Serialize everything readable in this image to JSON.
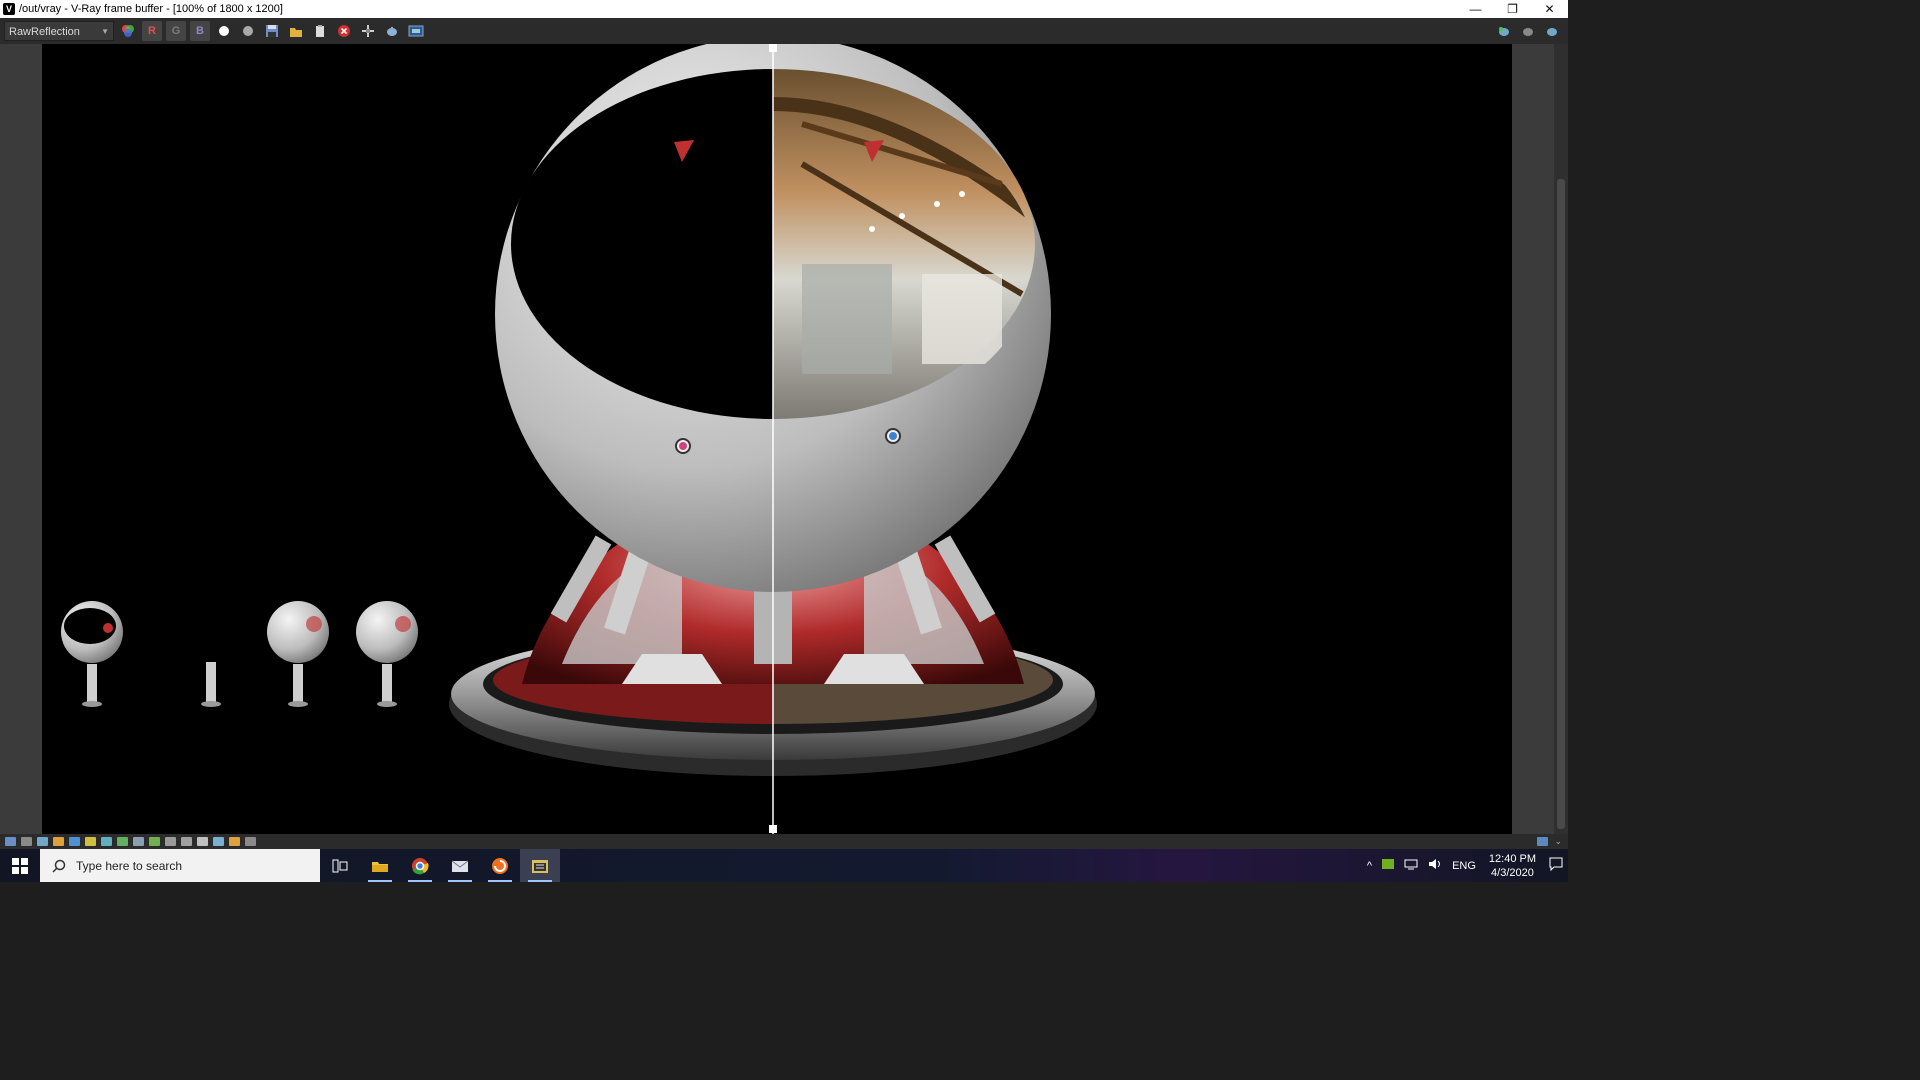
{
  "window": {
    "title": "/out/vray - V-Ray frame buffer - [100% of 1800 x 1200]",
    "app_icon_letter": "V",
    "min_glyph": "—",
    "restore_glyph": "❐",
    "close_glyph": "✕"
  },
  "toolbar": {
    "channel": "RawReflection",
    "channel_r": "R",
    "channel_g": "G",
    "channel_b": "B"
  },
  "taskbar": {
    "search_placeholder": "Type here to search",
    "language": "ENG",
    "time": "12:40 PM",
    "date": "4/3/2020"
  },
  "colors": {
    "viewport_bg": "#000000",
    "red_material": "#b02a2a",
    "chrome": "#c8c8c8",
    "toolbar_bg": "#2b2b2b"
  }
}
